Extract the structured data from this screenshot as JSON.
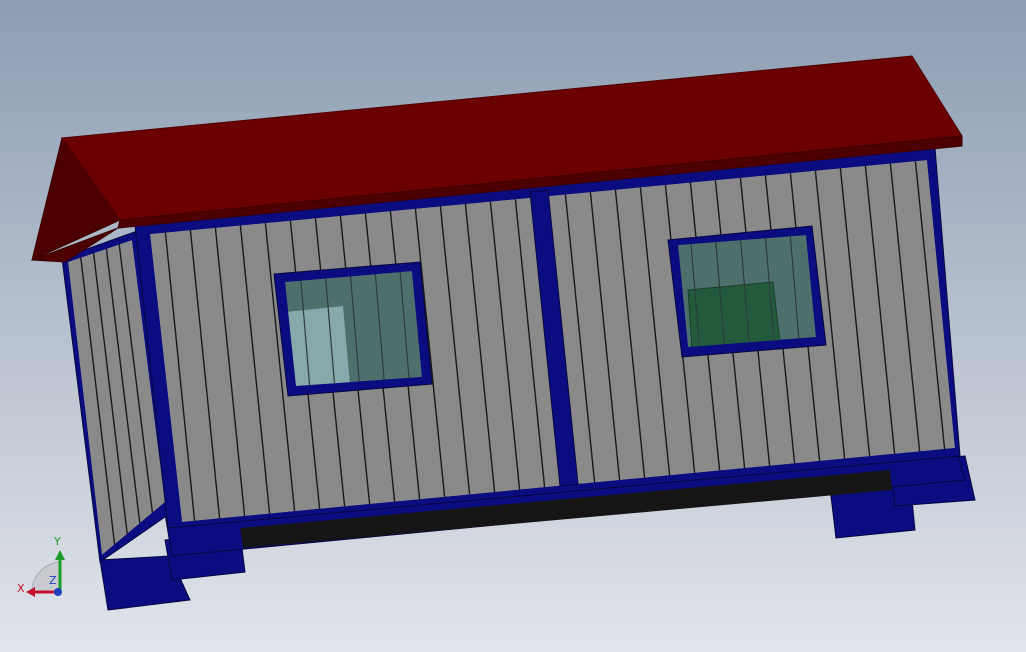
{
  "viewport": {
    "background_top": "#8d9db3",
    "background_bottom": "#e1e4ea"
  },
  "model": {
    "roof_color": "#6b0000",
    "roof_edge_color": "#4c0000",
    "frame_color": "#0b0c80",
    "panel_color": "#8a8a8a",
    "panel_line_color": "#1a1a1a",
    "glass_color": "#4e706c",
    "glass_light_color": "#86a9ab",
    "glass_green_color": "#245a3c",
    "base_shadow_color": "#151515"
  },
  "triad": {
    "x_label": "X",
    "y_label": "Y",
    "z_label": "Z",
    "x_color": "#c8102e",
    "y_color": "#1a9c2b",
    "z_color": "#1f3fbf"
  }
}
